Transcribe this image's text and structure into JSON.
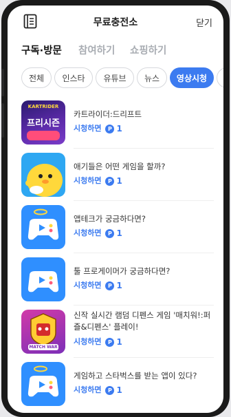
{
  "header": {
    "title": "무료충전소",
    "close_label": "닫기"
  },
  "tabs": [
    {
      "label": "구독·방문",
      "active": true
    },
    {
      "label": "참여하기",
      "active": false
    },
    {
      "label": "쇼핑하기",
      "active": false
    }
  ],
  "categories": [
    {
      "label": "전체",
      "active": false
    },
    {
      "label": "인스타",
      "active": false
    },
    {
      "label": "유튜브",
      "active": false
    },
    {
      "label": "뉴스",
      "active": false
    },
    {
      "label": "영상시청",
      "active": true
    },
    {
      "label": "기",
      "active": false
    }
  ],
  "thumb_texts": {
    "kart_top": "KARTRIDER",
    "kart_title": "프리시즌",
    "match_war": "MATCH WAR"
  },
  "items": [
    {
      "title": "카트라이더:드리프트",
      "reward_label": "시청하면",
      "points": "1",
      "badge": "P",
      "thumb": "kart-rider-thumbnail"
    },
    {
      "title": "애기들은 어떤 게임을 할까?",
      "reward_label": "시청하면",
      "points": "1",
      "badge": "P",
      "thumb": "yellow-chick-thumbnail"
    },
    {
      "title": "앱테크가 궁금하다면?",
      "reward_label": "시청하면",
      "points": "1",
      "badge": "P",
      "thumb": "gamepad-halo-thumbnail"
    },
    {
      "title": "툴 프로게이머가 궁금하다면?",
      "reward_label": "시청하면",
      "points": "1",
      "badge": "P",
      "thumb": "gamepad-thumbnail"
    },
    {
      "title": "신작 실시간 램덤 디펜스 게임 '매치워!:퍼즐&디펜스' 플레이!",
      "reward_label": "시청하면",
      "points": "1",
      "badge": "P",
      "thumb": "match-war-thumbnail"
    },
    {
      "title": "게임하고 스타벅스를 받는 앱이 있다?",
      "reward_label": "시청하면",
      "points": "1",
      "badge": "P",
      "thumb": "gamepad-halo-thumbnail"
    }
  ],
  "colors": {
    "accent": "#3c7bf0",
    "inactive_tab": "#a9adb3"
  }
}
